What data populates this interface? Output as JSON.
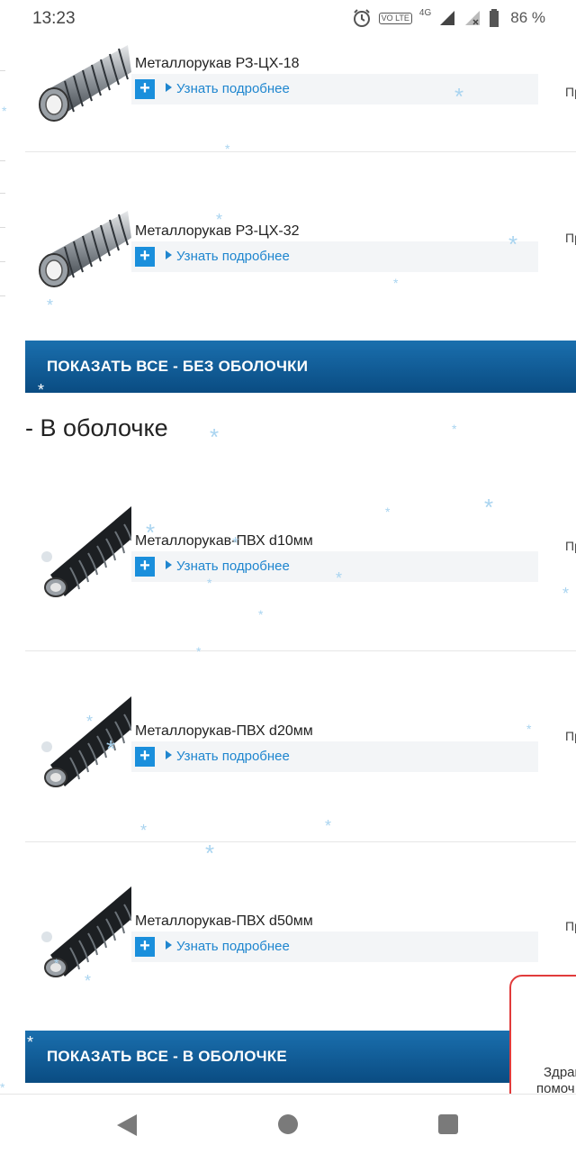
{
  "status_bar": {
    "time": "13:23",
    "battery": "86 %",
    "network": "4G",
    "volte": "VO LTE"
  },
  "section_no_sheath": {
    "products": [
      {
        "title": "Металлорукав РЗ-ЦХ-18",
        "more": "Узнать подробнее",
        "side": "Пр"
      },
      {
        "title": "Металлорукав РЗ-ЦХ-32",
        "more": "Узнать подробнее",
        "side": "Пр"
      }
    ],
    "show_all": "ПОКАЗАТЬ ВСЕ - БЕЗ ОБОЛОЧКИ"
  },
  "section_sheath": {
    "title": "- В оболочке",
    "products": [
      {
        "title": "Металлорукав-ПВХ d10мм",
        "more": "Узнать подробнее",
        "side": "Пр"
      },
      {
        "title": "Металлорукав-ПВХ d20мм",
        "more": "Узнать подробнее",
        "side": "Пр"
      },
      {
        "title": "Металлорукав-ПВХ d50мм",
        "more": "Узнать подробнее",
        "side": "Пр"
      }
    ],
    "show_all": "ПОКАЗАТЬ ВСЕ - В ОБОЛОЧКЕ"
  },
  "chat_widget": {
    "line1": "Здрав",
    "line2": "помоч"
  },
  "colors": {
    "accent_blue": "#1a8fdc",
    "banner_blue": "#0a4c82",
    "chat_border": "#e13b3b"
  },
  "icons": {
    "plus": "+",
    "snowflake": "*"
  }
}
